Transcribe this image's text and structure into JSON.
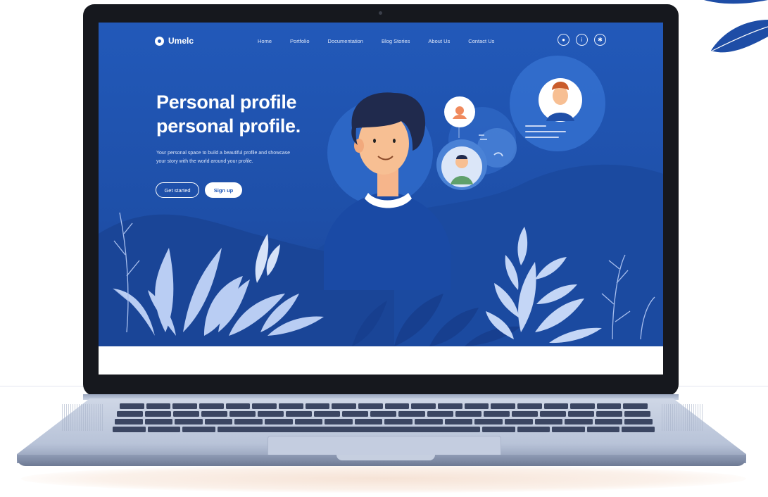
{
  "brand": {
    "logo_text": "Umelc"
  },
  "nav": {
    "items": [
      "Home",
      "Portfolio",
      "Documentation",
      "Blog Stories",
      "About Us",
      "Contact Us"
    ]
  },
  "nav_icons": [
    "account-icon",
    "info-icon",
    "settings-icon"
  ],
  "hero": {
    "title_line1": "Personal profile",
    "title_line2": "personal profile.",
    "subtitle_line1": "Your personal space to build a beautiful profile and showcase",
    "subtitle_line2": "your story with the world around your profile.",
    "button_outline": "Get started",
    "button_solid": "Sign up"
  },
  "colors": {
    "hero_blue": "#1f57b8",
    "leaf_light": "#c9d9f7",
    "leaf_dark": "#173f8f",
    "laptop_frame": "#16181e",
    "keyboard_keys": "#3b4662"
  }
}
